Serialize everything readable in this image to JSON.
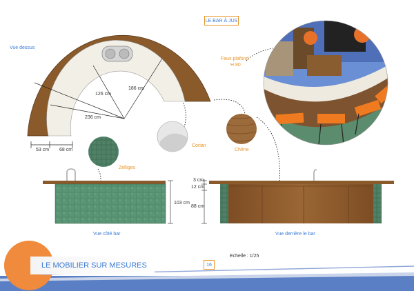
{
  "header": {
    "title": "LE BAR À JUS"
  },
  "top_view": {
    "label": "Vue dessus",
    "dim_inner_1": "126 cm",
    "dim_inner_2": "186 cm",
    "dim_radius": "236 cm",
    "dim_bottom_1": "53 cm",
    "dim_bottom_2": "68 cm"
  },
  "render_callout": {
    "line1": "Faux plafond",
    "line2": "H 80"
  },
  "materials": {
    "corian": "Corian",
    "chene": "Chêne",
    "zelliges": "Zelliges"
  },
  "side_view": {
    "label": "Vue côté bar",
    "dim_height": "103 cm"
  },
  "back_view": {
    "label": "Vue derrière le bar",
    "dim_top": "3 cm",
    "dim_mid": "12 cm",
    "dim_body": "88 cm"
  },
  "footer": {
    "banner_title": "LE MOBILIER SUR MESURES",
    "page_number": "16",
    "scale": "Echelle : 1/25"
  },
  "colors": {
    "wood": "#8b5a2b",
    "corian": "#f2efe6",
    "tile": "#4f8a6a",
    "accent_orange": "#e8962a",
    "accent_blue": "#3b7bd6"
  }
}
